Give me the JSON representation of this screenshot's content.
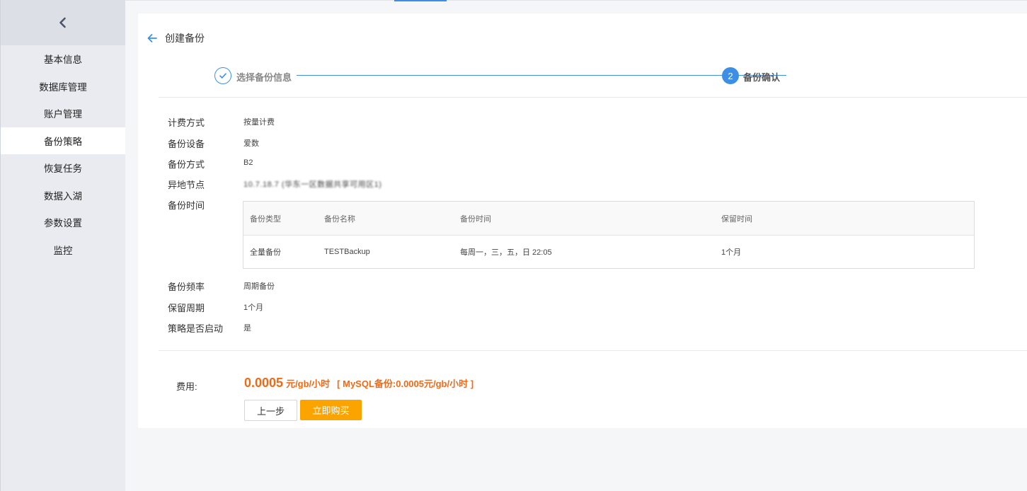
{
  "sidebar": {
    "items": [
      {
        "label": "基本信息"
      },
      {
        "label": "数据库管理"
      },
      {
        "label": "账户管理"
      },
      {
        "label": "备份策略",
        "active": true
      },
      {
        "label": "恢复任务"
      },
      {
        "label": "数据入湖"
      },
      {
        "label": "参数设置"
      },
      {
        "label": "监控"
      }
    ]
  },
  "header": {
    "title": "创建备份"
  },
  "steps": {
    "step1": {
      "label": "选择备份信息",
      "status": "done"
    },
    "step2": {
      "number": "2",
      "label": "备份确认",
      "status": "current"
    }
  },
  "info": {
    "billing_label": "计费方式",
    "billing_value": "按量计费",
    "device_label": "备份设备",
    "device_value": "爱数",
    "method_label": "备份方式",
    "method_value": "B2",
    "node_label": "异地节点",
    "node_value": "10.7.18.7 (华东一区数据共享可用区1)",
    "time_label": "备份时间",
    "freq_label": "备份频率",
    "freq_value": "周期备份",
    "retention_label": "保留周期",
    "retention_value": "1个月",
    "enabled_label": "策略是否启动",
    "enabled_value": "是"
  },
  "table": {
    "headers": [
      "备份类型",
      "备份名称",
      "备份时间",
      "保留时间"
    ],
    "rows": [
      [
        "全量备份",
        "TESTBackup",
        "每周一，三，五，日 22:05",
        "1个月"
      ]
    ]
  },
  "cost": {
    "label": "费用:",
    "amount": "0.0005",
    "unit": "元/gb/小时",
    "detail": "[ MySQL备份:0.0005元/gb/小时 ]"
  },
  "buttons": {
    "prev": "上一步",
    "buy": "立即购买"
  },
  "colors": {
    "accent": "#3d8fe6",
    "price": "#ee6a16",
    "buy": "#fba400"
  }
}
